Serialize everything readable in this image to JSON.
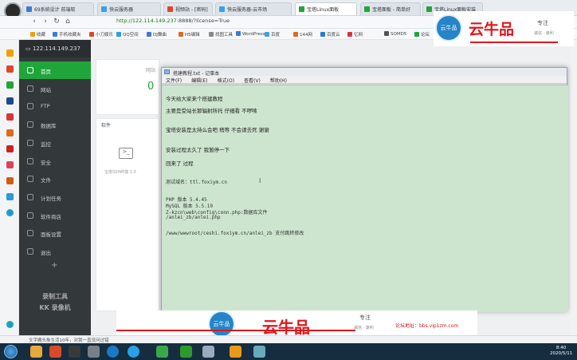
{
  "browser": {
    "tabs": [
      {
        "label": "69系统设计 前端软",
        "color": "#3b7bd8"
      },
      {
        "label": "快云服务器",
        "color": "#3aa0e8"
      },
      {
        "label": "视频站 - [密码]",
        "color": "#e0452a"
      },
      {
        "label": "快云服务器-云市场",
        "color": "#3aa0e8"
      },
      {
        "label": "宝塔Linux面板",
        "color": "#20a53a"
      },
      {
        "label": "宝塔面板 - 简单好",
        "color": "#20a53a"
      },
      {
        "label": "宝塔Linux面板安装",
        "color": "#20a53a"
      }
    ],
    "url_host": "http://122.114.149.237",
    "url_rest": ":8888/?license=True",
    "bookmarks": [
      "收藏",
      "手机收藏夹",
      "小刀娱乐",
      "QQ空间",
      "DJ舞曲",
      "H5编辑",
      "找图工具",
      "WordPress",
      "百度",
      "144网",
      "百度云",
      "亿网",
      "SOMD5",
      "论坛"
    ]
  },
  "sidebar": {
    "server_ip": "122.114.149.237",
    "items": [
      {
        "label": "首页",
        "active": true,
        "icon": "home-icon"
      },
      {
        "label": "网站",
        "active": false,
        "icon": "globe-icon"
      },
      {
        "label": "FTP",
        "active": false,
        "icon": "ftp-icon"
      },
      {
        "label": "数据库",
        "active": false,
        "icon": "database-icon"
      },
      {
        "label": "监控",
        "active": false,
        "icon": "monitor-icon"
      },
      {
        "label": "安全",
        "active": false,
        "icon": "shield-icon"
      },
      {
        "label": "文件",
        "active": false,
        "icon": "folder-icon"
      },
      {
        "label": "计划任务",
        "active": false,
        "icon": "clock-icon"
      },
      {
        "label": "软件商店",
        "active": false,
        "icon": "store-icon"
      },
      {
        "label": "面板设置",
        "active": false,
        "icon": "gear-icon"
      },
      {
        "label": "退出",
        "active": false,
        "icon": "logout-icon"
      }
    ],
    "add_symbol": "+",
    "watermark_line1": "录制工具",
    "watermark_line2": "KK 录像机"
  },
  "main": {
    "site_label": "网站",
    "site_count": "0",
    "software_label": "软件",
    "software_item": "宝塔SSH终端 1.0"
  },
  "notepad": {
    "title": "搭建教程.txt - 记事本",
    "menu": [
      "文件(F)",
      "编辑(E)",
      "格式(O)",
      "查看(V)",
      "帮助(H)"
    ],
    "lines": [
      "今天给大家来个搭建教程",
      "主要是受站长那辐射所托  仔细看  不啰嗦",
      "宝塔安装是太持么会吧  稍等  不会请去死  谢谢",
      "安装过程太久了  我暂停一下",
      "回来了    过程",
      "测试域名：ttl.foxiym.cn",
      "PHP 版本        5.4.45",
      "MySQL 版本      5.5.19",
      "Z-kzcn\\web\\config\\conn.php:数据库文件",
      "/anlei_zb/anlei.php",
      "/www/wwwroot/ceshi.foxiym.cn/anlei_zb 支付跳转修改"
    ]
  },
  "branding": {
    "cloud_label": "云牛品",
    "name": "云牛品",
    "focus": "专注",
    "slogan": "诚信 · 速利",
    "forum": "论坛地址：bbs.vip1zm.com"
  },
  "statusbar": {
    "text": "文字搬头象生活10年，对我一直没问过错"
  },
  "taskbar": {
    "time": "8:40",
    "date": "2020/5/11"
  },
  "colors": {
    "accent": "#20a53a",
    "sidebar": "#33383b",
    "notepad_bg": "#cde5cf",
    "brand_red": "#e0161b",
    "brand_blue": "#2585c8"
  }
}
